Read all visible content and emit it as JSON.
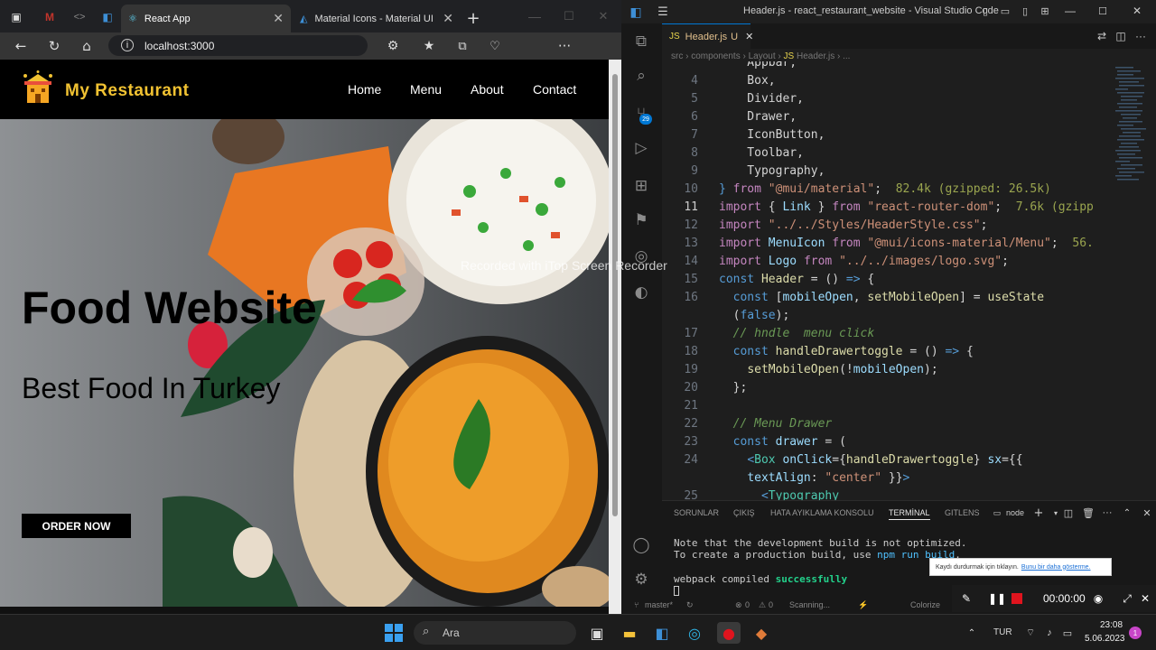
{
  "browser": {
    "tabs": [
      {
        "label": "React App",
        "active": true
      },
      {
        "label": "Material Icons - Material UI",
        "active": false
      }
    ],
    "url": "localhost:3000"
  },
  "site": {
    "brand": "My Restaurant",
    "nav": [
      "Home",
      "Menu",
      "About",
      "Contact"
    ],
    "hero_title": "Food Website",
    "hero_subtitle": "Best Food In Turkey",
    "cta": "ORDER NOW",
    "watermark": "Recorded with iTop Screen Recorder"
  },
  "vscode": {
    "title": "Header.js - react_restaurant_website - Visual Studio Code",
    "tab": "Header.js",
    "tab_status": "U",
    "breadcrumb": [
      "src",
      "components",
      "Layout",
      "Header.js",
      "..."
    ],
    "scm_badge": "29",
    "lines": [
      {
        "n": "",
        "html": "    Appbar,"
      },
      {
        "n": "4",
        "html": "    Box,"
      },
      {
        "n": "5",
        "html": "    Divider,"
      },
      {
        "n": "6",
        "html": "    Drawer,"
      },
      {
        "n": "7",
        "html": "    IconButton,"
      },
      {
        "n": "8",
        "html": "    Toolbar,"
      },
      {
        "n": "9",
        "html": "    Typography,"
      },
      {
        "n": "10",
        "html": "<span class='k'>}</span> <span class='kw'>from</span> <span class='s'>\"@mui/material\"</span>;  <span class='hint'>82.4k (gzipped: 26.5k)</span>"
      },
      {
        "n": "11",
        "html": "<span class='kw'>import</span> { <span class='v'>Link</span> } <span class='kw'>from</span> <span class='s'>\"react-router-dom\"</span>;  <span class='hint'>7.6k (gzipp</span>"
      },
      {
        "n": "12",
        "html": "<span class='kw'>import</span> <span class='s'>\"../../Styles/HeaderStyle.css\"</span>;"
      },
      {
        "n": "13",
        "html": "<span class='kw'>import</span> <span class='v'>MenuIcon</span> <span class='kw'>from</span> <span class='s'>\"@mui/icons-material/Menu\"</span>;  <span class='hint'>56.</span>"
      },
      {
        "n": "14",
        "html": "<span class='kw'>import</span> <span class='v'>Logo</span> <span class='kw'>from</span> <span class='s'>\"../../images/logo.svg\"</span>;"
      },
      {
        "n": "15",
        "html": "<span class='k'>const</span> <span class='f'>Header</span> = () <span class='k'>=&gt;</span> {"
      },
      {
        "n": "16",
        "html": "  <span class='k'>const</span> [<span class='v'>mobileOpen</span>, <span class='f'>setMobileOpen</span>] = <span class='f'>useState</span>"
      },
      {
        "n": "",
        "html": "  (<span class='k'>false</span>);"
      },
      {
        "n": "17",
        "html": "  <span class='c'>// hndle  menu click</span>"
      },
      {
        "n": "18",
        "html": "  <span class='k'>const</span> <span class='f'>handleDrawertoggle</span> = () <span class='k'>=&gt;</span> {"
      },
      {
        "n": "19",
        "html": "    <span class='f'>setMobileOpen</span>(!<span class='v'>mobileOpen</span>);"
      },
      {
        "n": "20",
        "html": "  };"
      },
      {
        "n": "21",
        "html": ""
      },
      {
        "n": "22",
        "html": "  <span class='c'>// Menu Drawer</span>"
      },
      {
        "n": "23",
        "html": "  <span class='k'>const</span> <span class='v'>drawer</span> = ("
      },
      {
        "n": "24",
        "html": "    <span class='k'>&lt;</span><span class='t'>Box</span> <span class='v'>onClick</span>={<span class='f'>handleDrawertoggle</span>} <span class='v'>sx</span>={{"
      },
      {
        "n": "",
        "html": "    <span class='v'>textAlign</span>: <span class='s'>\"center\"</span> }}<span class='k'>&gt;</span>"
      },
      {
        "n": "25",
        "html": "      <span class='k'>&lt;</span><span class='t'>Typography</span>"
      }
    ],
    "current_line": "11",
    "panel_tabs": [
      "SORUNLAR",
      "ÇIKIŞ",
      "HATA AYIKLAMA KONSOLU",
      "TERMİNAL",
      "GITLENS"
    ],
    "terminal_name": "node",
    "terminal": [
      "Note that the development build is not optimized.",
      "To create a production build, use npm run build.",
      "",
      "webpack compiled successfully"
    ],
    "status_left": "master*",
    "status_errors": "0",
    "status_warnings": "0",
    "status_scanning": "Scanning...",
    "status_right": "Colorize"
  },
  "recorder": {
    "tip": "Kaydı durdurmak için tıklayın.",
    "tip_link": "Bunu bir daha gösterme.",
    "time": "00:00:00"
  },
  "taskbar": {
    "search": "Ara",
    "lang": "TUR",
    "time": "23:08",
    "date": "5.06.2023"
  }
}
